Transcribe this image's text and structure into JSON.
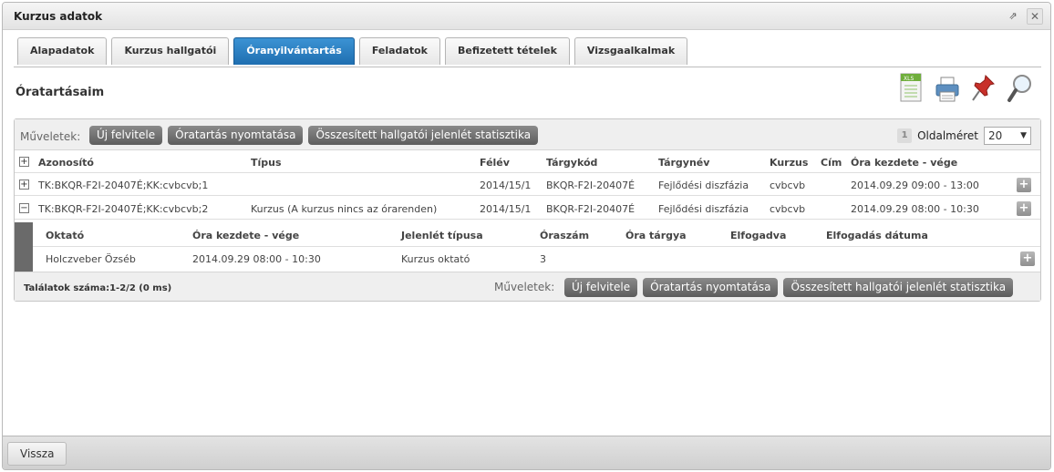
{
  "window": {
    "title": "Kurzus adatok"
  },
  "tabs": [
    {
      "label": "Alapadatok"
    },
    {
      "label": "Kurzus hallgatói"
    },
    {
      "label": "Óranyilvántartás"
    },
    {
      "label": "Feladatok"
    },
    {
      "label": "Befizetett tételek"
    },
    {
      "label": "Vizsgaalkalmak"
    }
  ],
  "active_tab": "Óranyilvántartás",
  "section": {
    "title": "Óratartásaim"
  },
  "toolbar_icons": [
    "xls-export-icon",
    "print-icon",
    "pin-icon",
    "search-icon"
  ],
  "top_actions": {
    "label": "Műveletek:",
    "buttons": [
      "Új felvitele",
      "Óratartás nyomtatása",
      "Összesített hallgatói jelenlét statisztika"
    ]
  },
  "pager": {
    "page": "1",
    "size_label": "Oldalméret",
    "size_value": "20"
  },
  "table": {
    "headers": [
      "Azonosító",
      "Típus",
      "Félév",
      "Tárgykód",
      "Tárgynév",
      "Kurzus",
      "Cím",
      "Óra kezdete - vége"
    ],
    "rows": [
      {
        "expander": "+",
        "cells": [
          "TK:BKQR-F2I-20407É;KK:cvbcvb;1",
          "",
          "2014/15/1",
          "BKQR-F2I-20407É",
          "Fejlődési diszfázia",
          "cvbcvb",
          "",
          "2014.09.29 09:00 - 13:00"
        ]
      },
      {
        "expander": "−",
        "cells": [
          "TK:BKQR-F2I-20407É;KK:cvbcvb;2",
          "Kurzus (A kurzus nincs az órarenden)",
          "2014/15/1",
          "BKQR-F2I-20407É",
          "Fejlődési diszfázia",
          "cvbcvb",
          "",
          "2014.09.29 08:00 - 10:30"
        ]
      }
    ]
  },
  "subtable": {
    "headers": [
      "Oktató",
      "Óra kezdete - vége",
      "Jelenlét típusa",
      "Óraszám",
      "Óra tárgya",
      "Elfogadva",
      "Elfogadás dátuma"
    ],
    "rows": [
      {
        "cells": [
          "Holczveber Özséb",
          "2014.09.29 08:00 - 10:30",
          "Kurzus oktató",
          "3",
          "",
          "",
          ""
        ]
      }
    ]
  },
  "footer": {
    "found": "Találatok száma:1-2/2 (0 ms)",
    "label": "Műveletek:",
    "buttons": [
      "Új felvitele",
      "Óratartás nyomtatása",
      "Összesített hallgatói jelenlét statisztika"
    ]
  },
  "bottom": {
    "back_label": "Vissza"
  },
  "colors": {
    "active_tab": "#2a7fc3",
    "button": "#6e6e6e"
  }
}
